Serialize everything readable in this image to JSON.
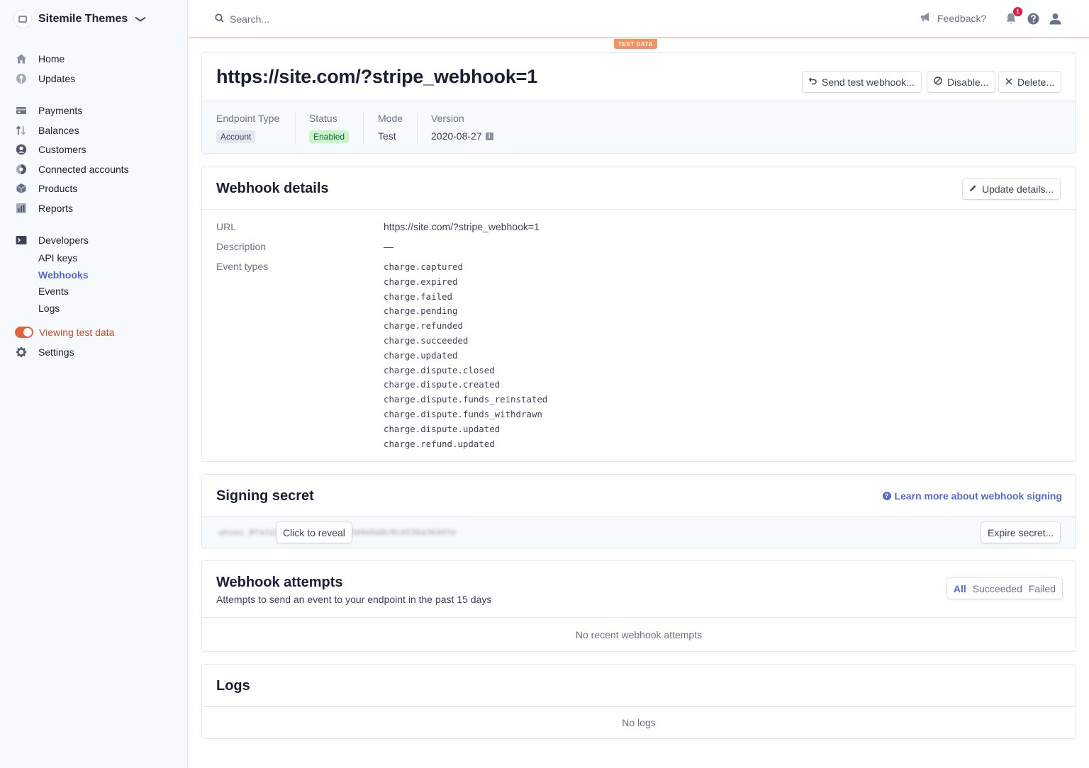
{
  "sidebar": {
    "account_name": "Sitemile Themes",
    "items": [
      {
        "label": "Home",
        "icon": "home-icon"
      },
      {
        "label": "Updates",
        "icon": "updates-icon"
      },
      {
        "label": "Payments",
        "icon": "payments-icon"
      },
      {
        "label": "Balances",
        "icon": "balances-icon"
      },
      {
        "label": "Customers",
        "icon": "customers-icon"
      },
      {
        "label": "Connected accounts",
        "icon": "connected-accounts-icon"
      },
      {
        "label": "Products",
        "icon": "products-icon"
      },
      {
        "label": "Reports",
        "icon": "reports-icon"
      },
      {
        "label": "Developers",
        "icon": "developers-icon"
      }
    ],
    "developer_subitems": [
      "API keys",
      "Webhooks",
      "Events",
      "Logs"
    ],
    "active_subitem": "Webhooks",
    "test_toggle_label": "Viewing test data",
    "settings_label": "Settings"
  },
  "topbar": {
    "search_placeholder": "Search...",
    "feedback_label": "Feedback?",
    "notification_count": "1",
    "test_data_tag": "TEST DATA"
  },
  "endpoint": {
    "title": "https://site.com/?stripe_webhook=1",
    "actions": {
      "send_test": "Send test webhook...",
      "disable": "Disable...",
      "delete": "Delete..."
    },
    "meta": {
      "endpoint_type_label": "Endpoint Type",
      "endpoint_type_value": "Account",
      "status_label": "Status",
      "status_value": "Enabled",
      "mode_label": "Mode",
      "mode_value": "Test",
      "version_label": "Version",
      "version_value": "2020-08-27"
    }
  },
  "webhook_details": {
    "title": "Webhook details",
    "update_button": "Update details...",
    "url_label": "URL",
    "url_value": "https://site.com/?stripe_webhook=1",
    "description_label": "Description",
    "description_value": "—",
    "event_types_label": "Event types",
    "event_types": [
      "charge.captured",
      "charge.expired",
      "charge.failed",
      "charge.pending",
      "charge.refunded",
      "charge.succeeded",
      "charge.updated",
      "charge.dispute.closed",
      "charge.dispute.created",
      "charge.dispute.funds_reinstated",
      "charge.dispute.funds_withdrawn",
      "charge.dispute.updated",
      "charge.refund.updated"
    ]
  },
  "signing_secret": {
    "title": "Signing secret",
    "learn_more": "Learn more about webhook signing",
    "reveal_button": "Click to reveal",
    "expire_button": "Expire secret..."
  },
  "webhook_attempts": {
    "title": "Webhook attempts",
    "subtitle": "Attempts to send an event to your endpoint in the past 15 days",
    "filters": [
      "All",
      "Succeeded",
      "Failed"
    ],
    "active_filter": "All",
    "empty_text": "No recent webhook attempts"
  },
  "logs": {
    "title": "Logs",
    "empty_text": "No logs"
  },
  "colors": {
    "accent": "#5469d4",
    "test_orange": "#f5925e",
    "test_text": "#cd4c26",
    "enabled_bg": "#cbf4c9",
    "enabled_text": "#0e6245"
  }
}
